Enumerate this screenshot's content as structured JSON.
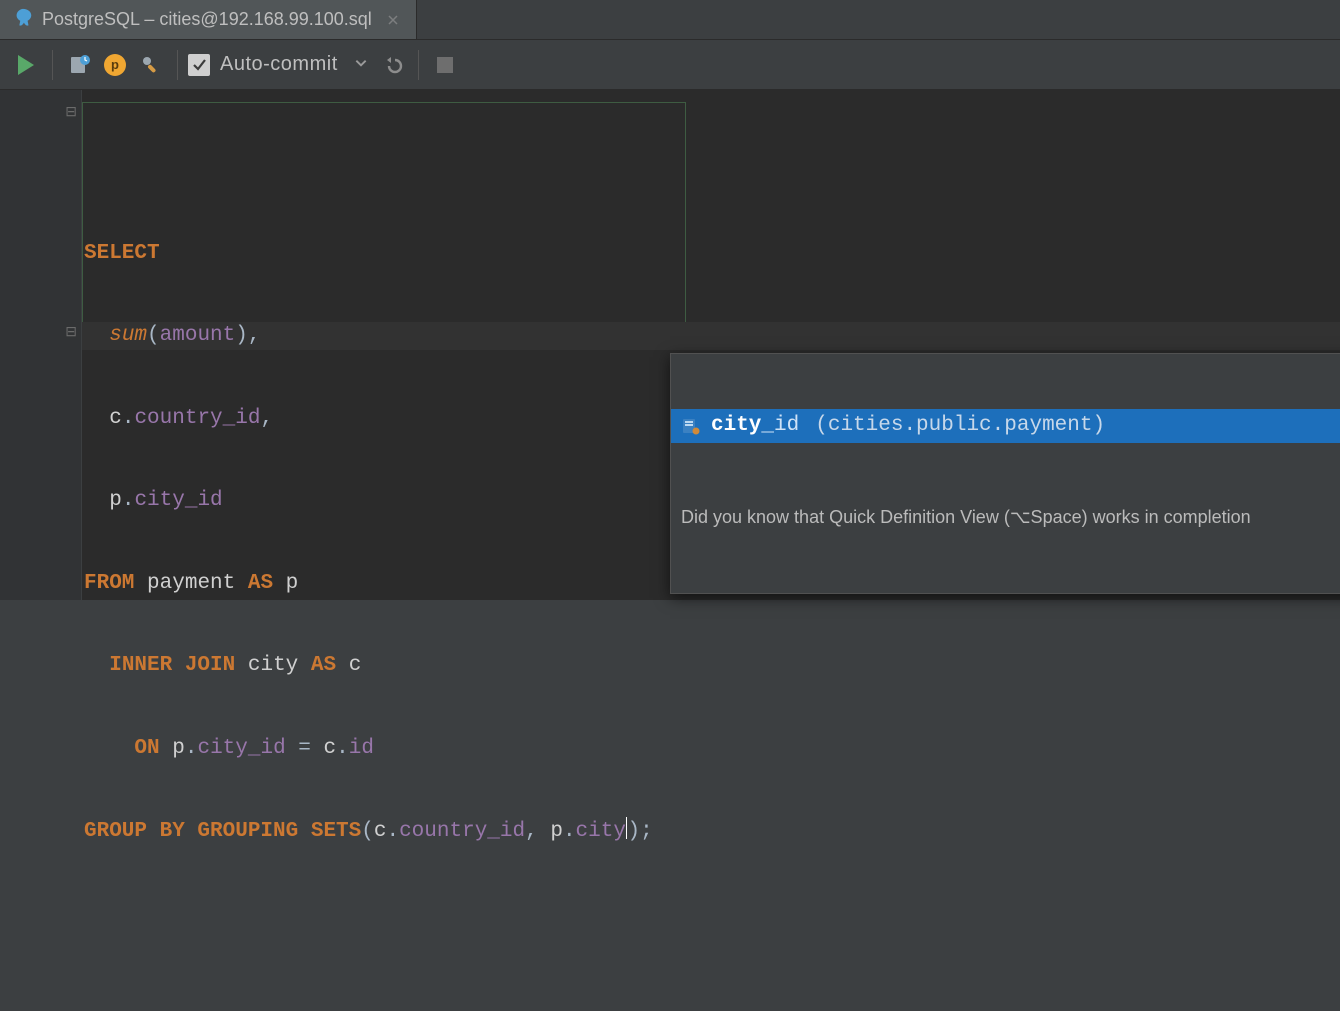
{
  "tab": {
    "title": "PostgreSQL – cities@192.168.99.100.sql",
    "icon": "postgresql-elephant-icon"
  },
  "toolbar": {
    "run_label": "Run",
    "autocommit_label": "Auto-commit",
    "autocommit_checked": true
  },
  "sql": {
    "line1": {
      "t1": "SELECT"
    },
    "line2": {
      "indent": "  ",
      "fn": "sum",
      "lp": "(",
      "arg": "amount",
      "rp": "),",
      "trail": ""
    },
    "line3": {
      "indent": "  ",
      "alias": "c",
      "dot": ".",
      "col": "country_id",
      "comma": ","
    },
    "line4": {
      "indent": "  ",
      "alias": "p",
      "dot": ".",
      "col": "city_id"
    },
    "line5": {
      "kw": "FROM",
      "sp": " ",
      "tbl": "payment",
      "as": " AS ",
      "a": "p"
    },
    "line6": {
      "indent": "  ",
      "kw": "INNER JOIN",
      "sp": " ",
      "tbl": "city",
      "as": " AS ",
      "a": "c"
    },
    "line7": {
      "indent": "    ",
      "kw": "ON",
      "sp": " ",
      "l_alias": "p",
      "l_dot": ".",
      "l_col": "city_id",
      "eq": " = ",
      "r_alias": "c",
      "r_dot": ".",
      "r_col": "id"
    },
    "line8": {
      "kw": "GROUP BY GROUPING SETS",
      "lp": "(",
      "a1": "c",
      "d1": ".",
      "c1": "country_id",
      "comma": ", ",
      "a2": "p",
      "d2": ".",
      "c2": "city",
      "tail": ");"
    }
  },
  "completion": {
    "typed": "city",
    "item_rest": "_id",
    "item_tail": "(cities.public.payment)",
    "tip": "Did you know that Quick Definition View (⌥Space) works in completion"
  }
}
